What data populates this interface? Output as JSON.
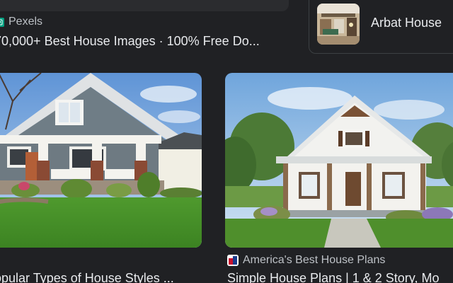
{
  "results": {
    "top_left": {
      "source": "Pexels",
      "title": "70,000+ Best House Images · 100% Free Do..."
    },
    "top_right": {
      "title": "Arbat House"
    },
    "bottom_left": {
      "title": "opular Types of House Styles ..."
    },
    "bottom_right": {
      "source": "America's Best House Plans",
      "title": "Simple House Plans | 1 & 2 Story, Mo"
    }
  },
  "icons": {
    "pexels": "pexels-logo-icon",
    "abhp": "americas-best-house-plans-logo-icon"
  },
  "colors": {
    "background": "#202124",
    "text_primary": "#e8eaed",
    "text_secondary": "#bdc1c6",
    "pexels_green": "#05a081"
  }
}
